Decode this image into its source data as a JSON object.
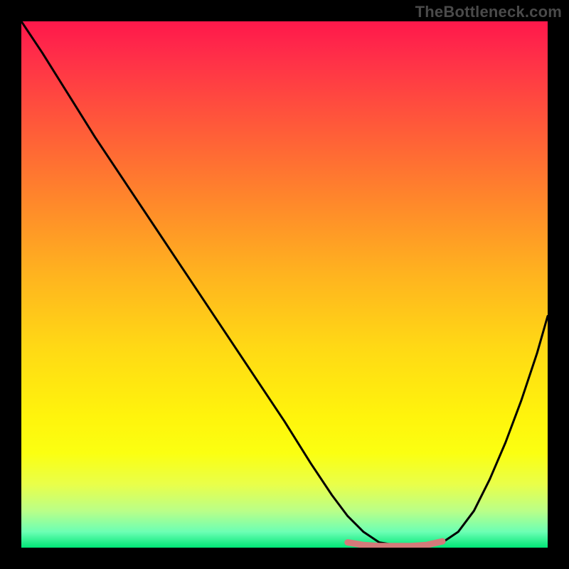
{
  "watermark": "TheBottleneck.com",
  "chart_data": {
    "type": "line",
    "title": "",
    "xlabel": "",
    "ylabel": "",
    "xlim": [
      0,
      100
    ],
    "ylim": [
      0,
      100
    ],
    "grid": false,
    "legend": false,
    "series": [
      {
        "name": "bottleneck-curve",
        "x": [
          0,
          4,
          9,
          14,
          20,
          26,
          32,
          38,
          44,
          50,
          55,
          59,
          62,
          65,
          68,
          71,
          74,
          77,
          80,
          83,
          86,
          89,
          92,
          95,
          98,
          100
        ],
        "values": [
          100,
          94,
          86,
          78,
          69,
          60,
          51,
          42,
          33,
          24,
          16,
          10,
          6,
          3,
          1,
          0.5,
          0.5,
          0.5,
          1,
          3,
          7,
          13,
          20,
          28,
          37,
          44
        ]
      },
      {
        "name": "highlight-band",
        "x": [
          62,
          65,
          68,
          71,
          74,
          77,
          80
        ],
        "values": [
          1,
          0.5,
          0.3,
          0.3,
          0.3,
          0.5,
          1.2
        ]
      }
    ],
    "colors": {
      "curve": "#000000",
      "highlight": "#d47a7a"
    }
  }
}
